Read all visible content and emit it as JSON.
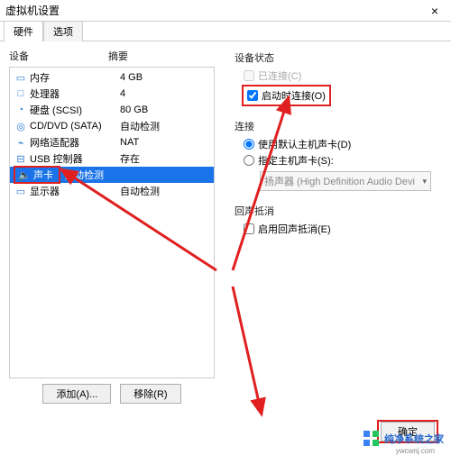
{
  "window": {
    "title": "虚拟机设置",
    "close": "×"
  },
  "tabs": {
    "hardware": "硬件",
    "options": "选项"
  },
  "columns": {
    "device": "设备",
    "summary": "摘要"
  },
  "hw": [
    {
      "icon": "▭",
      "name": "内存",
      "summary": "4 GB"
    },
    {
      "icon": "□",
      "name": "处理器",
      "summary": "4"
    },
    {
      "icon": "◔",
      "name": "硬盘 (SCSI)",
      "summary": "80 GB"
    },
    {
      "icon": "◎",
      "name": "CD/DVD (SATA)",
      "summary": "自动检测"
    },
    {
      "icon": "⌁",
      "name": "网络适配器",
      "summary": "NAT"
    },
    {
      "icon": "⊟",
      "name": "USB 控制器",
      "summary": "存在"
    },
    {
      "icon": "🔈",
      "name": "声卡",
      "summary": "自动检测"
    },
    {
      "icon": "▭",
      "name": "显示器",
      "summary": "自动检测"
    }
  ],
  "leftButtons": {
    "add": "添加(A)...",
    "remove": "移除(R)"
  },
  "right": {
    "status": {
      "title": "设备状态",
      "connected": "已连接(C)",
      "connectAtPower": "启动时连接(O)"
    },
    "connection": {
      "title": "连接",
      "useDefault": "使用默认主机声卡(D)",
      "specify": "指定主机声卡(S):",
      "dropdown": "扬声器 (High Definition Audio Devi"
    },
    "echo": {
      "title": "回声抵消",
      "enable": "启用回声抵消(E)"
    }
  },
  "footer": {
    "ok": "确定"
  },
  "watermark": {
    "text": "纯净系统之家",
    "url": "ywcwnj.com"
  }
}
